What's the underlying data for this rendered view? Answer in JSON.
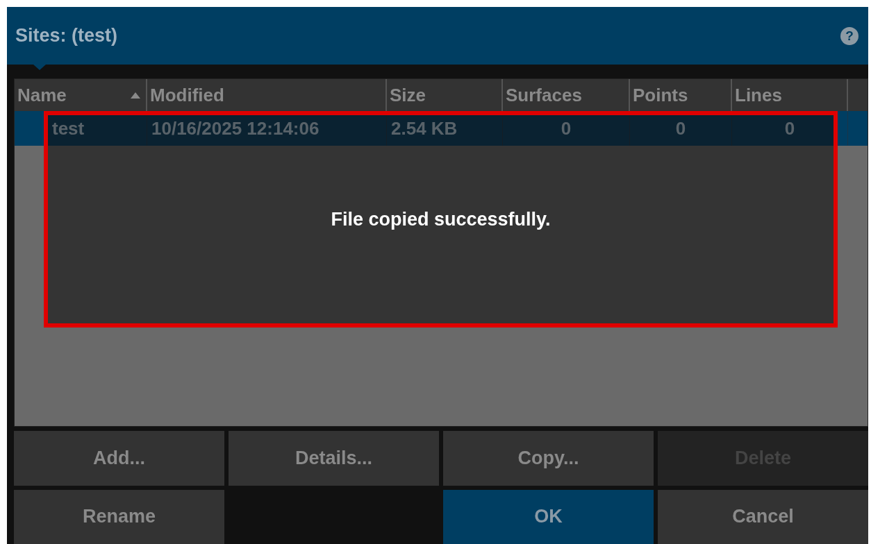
{
  "window": {
    "title": "Sites: (test)",
    "help": "?"
  },
  "table": {
    "columns": [
      {
        "label": "Name",
        "sorted": true
      },
      {
        "label": "Modified",
        "sorted": false
      },
      {
        "label": "Size",
        "sorted": false
      },
      {
        "label": "Surfaces",
        "sorted": false
      },
      {
        "label": "Points",
        "sorted": false
      },
      {
        "label": "Lines",
        "sorted": false
      }
    ],
    "rows": [
      {
        "selected": true,
        "cells": [
          "test",
          "10/16/2025 12:14:06",
          "2.54 KB",
          "0",
          "0",
          "0"
        ]
      }
    ]
  },
  "message": {
    "text": "File copied successfully."
  },
  "buttons": [
    {
      "label": "Add...",
      "kind": "normal",
      "disabled": false
    },
    {
      "label": "Details...",
      "kind": "normal",
      "disabled": false
    },
    {
      "label": "Copy...",
      "kind": "normal",
      "disabled": false
    },
    {
      "label": "Delete",
      "kind": "normal",
      "disabled": true
    },
    {
      "label": "Rename",
      "kind": "normal",
      "disabled": false
    },
    {
      "kind": "blank"
    },
    {
      "label": "OK",
      "kind": "primary",
      "disabled": false
    },
    {
      "label": "Cancel",
      "kind": "normal",
      "disabled": false
    }
  ]
}
